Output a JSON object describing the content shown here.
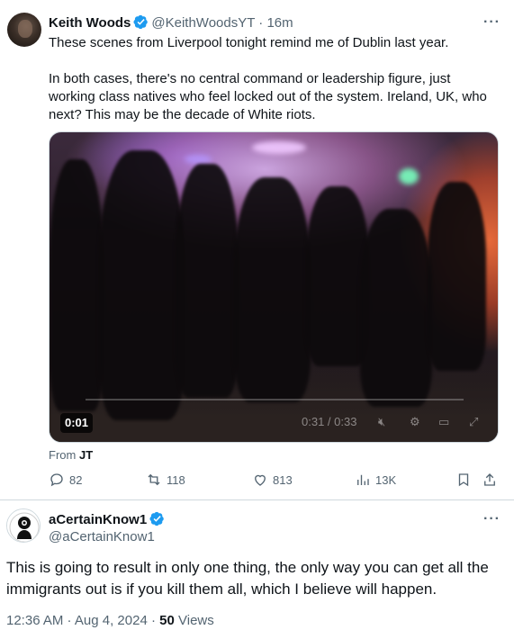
{
  "quoted_tweet": {
    "author_name": "Keith Woods",
    "author_handle": "@KeithWoodsYT",
    "separator": "·",
    "time": "16m",
    "more_label": "···",
    "text_paragraph_1": "These scenes from Liverpool tonight remind me of Dublin last year.",
    "text_paragraph_2": "In both cases, there's no central command or leadership figure, just working class natives who feel locked out of the system. Ireland, UK, who next? This may be the decade of White riots.",
    "video": {
      "elapsed_badge": "0:01",
      "time_readout": "0:31 / 0:33"
    },
    "from_prefix": "From",
    "from_source": "JT",
    "actions": {
      "replies": "82",
      "reposts": "118",
      "likes": "813",
      "views": "13K"
    }
  },
  "main_tweet": {
    "author_name": "aCertainKnow1",
    "author_handle": "@aCertainKnow1",
    "more_label": "···",
    "text": "This is going to result in only one thing, the only way you can get all the immigrants out is if you kill them all, which I believe will happen.",
    "timestamp": "12:36 AM · Aug 4, 2024",
    "separator": " · ",
    "views_count": "50",
    "views_label": "Views"
  },
  "colors": {
    "verified_blue": "#1d9bf0",
    "secondary_text": "#536471",
    "border": "#cfd9de"
  }
}
